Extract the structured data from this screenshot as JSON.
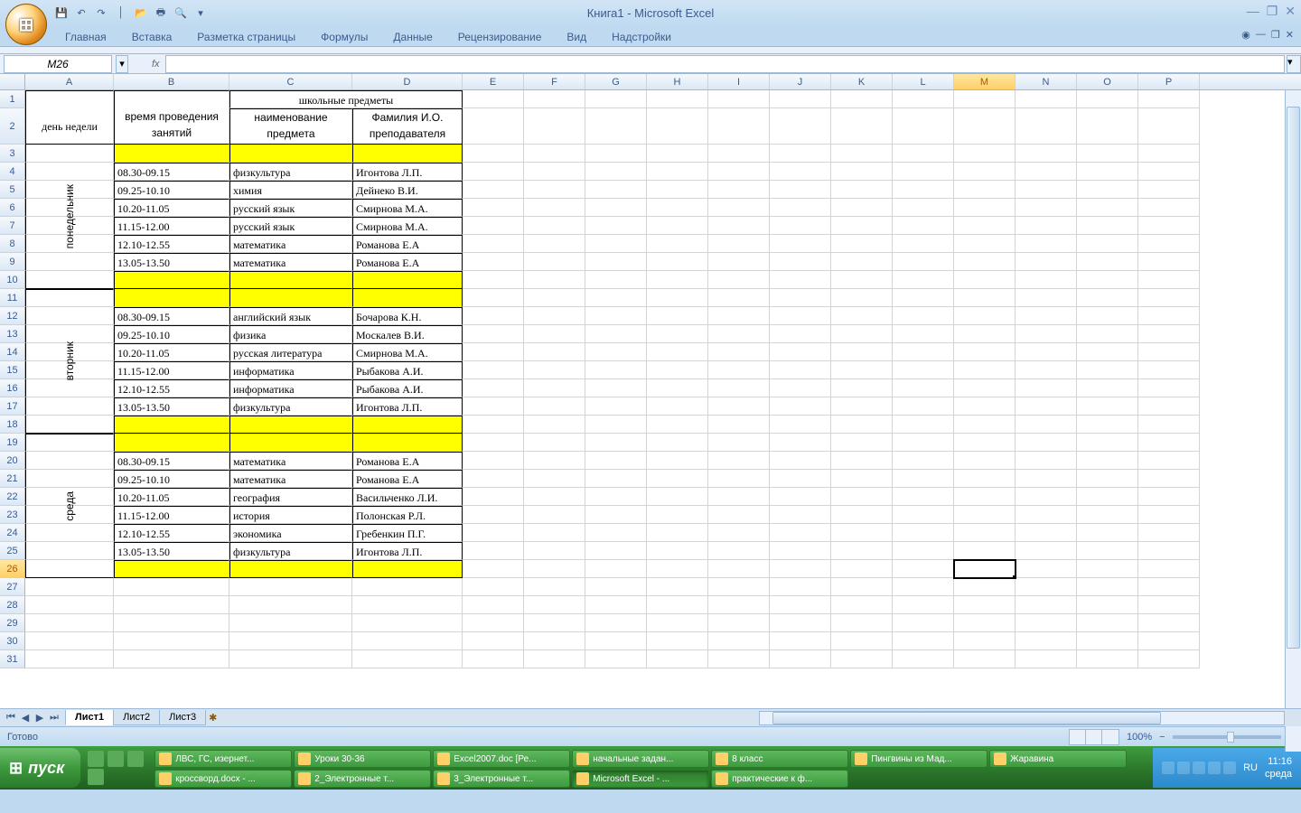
{
  "app": {
    "title": "Книга1 - Microsoft Excel"
  },
  "qat_icons": [
    "save-icon",
    "undo-icon",
    "redo-icon",
    "spacer",
    "open-icon",
    "print-icon",
    "preview-icon"
  ],
  "tabs": [
    "Главная",
    "Вставка",
    "Разметка страницы",
    "Формулы",
    "Данные",
    "Рецензирование",
    "Вид",
    "Надстройки"
  ],
  "name_box": "M26",
  "fx": "fx",
  "columns": [
    "A",
    "B",
    "C",
    "D",
    "E",
    "F",
    "G",
    "H",
    "I",
    "J",
    "K",
    "L",
    "M",
    "N",
    "O",
    "P"
  ],
  "active_col": "M",
  "active_row": 26,
  "headers": {
    "day": "день недели",
    "time": "время проведения занятий",
    "school_merge": "школьные предметы",
    "subject": "наименование предмета",
    "teacher": "Фамилия И.О. преподавателя"
  },
  "days": [
    {
      "label": "понедельник",
      "rows": [
        {
          "t": "08.30-09.15",
          "s": "физкультура",
          "p": "Игонтова Л.П."
        },
        {
          "t": "09.25-10.10",
          "s": "химия",
          "p": "Дейнеко В.И."
        },
        {
          "t": "10.20-11.05",
          "s": "русский язык",
          "p": "Смирнова М.А."
        },
        {
          "t": "11.15-12.00",
          "s": "русский язык",
          "p": "Смирнова М.А."
        },
        {
          "t": "12.10-12.55",
          "s": "математика",
          "p": "Романова Е.А"
        },
        {
          "t": "13.05-13.50",
          "s": "математика",
          "p": "Романова Е.А"
        }
      ]
    },
    {
      "label": "вторник",
      "rows": [
        {
          "t": "08.30-09.15",
          "s": "английский язык",
          "p": "Бочарова К.Н."
        },
        {
          "t": "09.25-10.10",
          "s": "физика",
          "p": "Москалев В.И."
        },
        {
          "t": "10.20-11.05",
          "s": "русская литература",
          "p": "Смирнова М.А."
        },
        {
          "t": "11.15-12.00",
          "s": "информатика",
          "p": "Рыбакова А.И."
        },
        {
          "t": "12.10-12.55",
          "s": "информатика",
          "p": "Рыбакова А.И."
        },
        {
          "t": "13.05-13.50",
          "s": "физкультура",
          "p": "Игонтова Л.П."
        }
      ]
    },
    {
      "label": "среда",
      "rows": [
        {
          "t": "08.30-09.15",
          "s": "математика",
          "p": "Романова Е.А"
        },
        {
          "t": "09.25-10.10",
          "s": "математика",
          "p": "Романова Е.А"
        },
        {
          "t": "10.20-11.05",
          "s": "география",
          "p": "Васильченко Л.И."
        },
        {
          "t": "11.15-12.00",
          "s": "история",
          "p": "Полонская Р.Л."
        },
        {
          "t": "12.10-12.55",
          "s": "экономика",
          "p": "Гребенкин П.Г."
        },
        {
          "t": "13.05-13.50",
          "s": "физкультура",
          "p": "Игонтова Л.П."
        }
      ]
    }
  ],
  "sheet_tabs": [
    "Лист1",
    "Лист2",
    "Лист3"
  ],
  "status": {
    "ready": "Готово",
    "zoom": "100%"
  },
  "taskbar": {
    "start": "пуск",
    "items": [
      "ЛВС, ГС, изернет...",
      "Уроки 30-36",
      "Excel2007.doc [Ре...",
      "начальные задан...",
      "8 класс",
      "Пингвины из Мад...",
      "Жаравина",
      "кроссворд.docx - ...",
      "2_Электронные т...",
      "3_Электронные т...",
      "Microsoft Excel - ...",
      "практические к ф..."
    ],
    "active_index": 10,
    "lang": "RU",
    "time": "11:16",
    "date": "среда"
  }
}
